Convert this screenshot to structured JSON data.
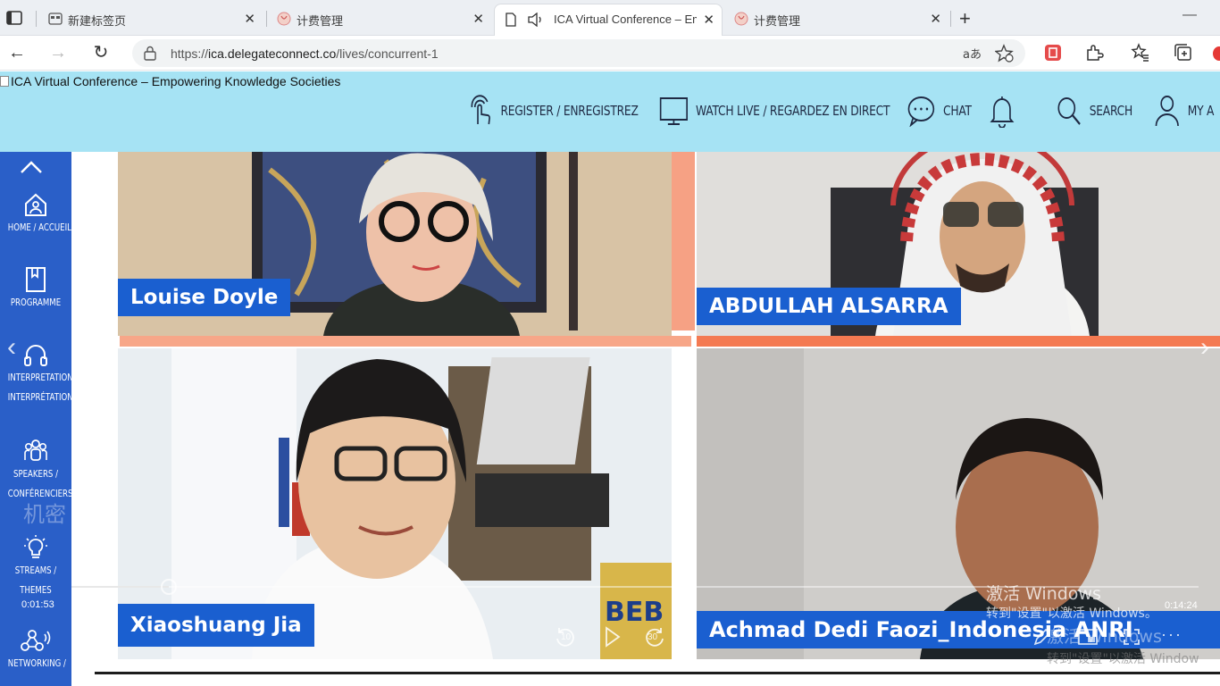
{
  "browser": {
    "tabs": [
      {
        "title": "新建标签页",
        "icon": "new-tab-page-icon"
      },
      {
        "title": "计费管理",
        "icon": "billing-icon"
      },
      {
        "title": "ICA Virtual Conference – Em",
        "icon": "document-icon",
        "audio": true,
        "active": true
      },
      {
        "title": "计费管理",
        "icon": "billing-icon"
      }
    ],
    "url_prefix": "https://",
    "url_host": "ica.delegateconnect.co",
    "url_path": "/lives/concurrent-1"
  },
  "site": {
    "logo_alt": "ICA Virtual Conference – Empowering Knowledge Societies",
    "nav": [
      {
        "label": "REGISTER / ENREGISTREZ",
        "icon": "touch-hand-icon"
      },
      {
        "label": "WATCH LIVE / REGARDEZ EN DIRECT",
        "icon": "monitor-icon"
      },
      {
        "label": "CHAT",
        "icon": "chat-bubble-icon"
      },
      {
        "label": "",
        "icon": "bell-icon"
      },
      {
        "label": "SEARCH",
        "icon": "search-icon"
      },
      {
        "label": "MY A",
        "icon": "user-icon"
      }
    ]
  },
  "sidebar": {
    "items": [
      {
        "line1": "HOME / ACCUEIL",
        "line2": "",
        "icon": "home-icon"
      },
      {
        "line1": "PROGRAMME",
        "line2": "",
        "icon": "bookmark-icon"
      },
      {
        "line1": "INTERPRETATION /",
        "line2": "INTERPRÉTATION",
        "icon": "headset-icon"
      },
      {
        "line1": "SPEAKERS /",
        "line2": "CONFÉRENCIERS",
        "icon": "people-icon"
      },
      {
        "line1": "STREAMS /",
        "line2": "THEMES",
        "icon": "lightbulb-icon"
      },
      {
        "line1": "NETWORKING /",
        "line2": "",
        "icon": "network-icon"
      }
    ],
    "watermark": "机密"
  },
  "video": {
    "participants": [
      {
        "name": "Louise Doyle"
      },
      {
        "name": "ABDULLAH ALSARRA"
      },
      {
        "name": "Xiaoshuang Jia"
      },
      {
        "name": "Achmad Dedi Faozi_Indonesia ANRI"
      }
    ],
    "elapsed": "0:01:53",
    "remaining": "0:14:24",
    "progress_fraction": 0.086,
    "rewind_label": "10",
    "forward_label": "30"
  },
  "watermark": {
    "line1": "激活 Windows",
    "line2": "转到\"设置\"以激活 Windows。",
    "ghost1": "激活 Windows",
    "ghost2": "转到\"设置\"以激活 Window"
  }
}
